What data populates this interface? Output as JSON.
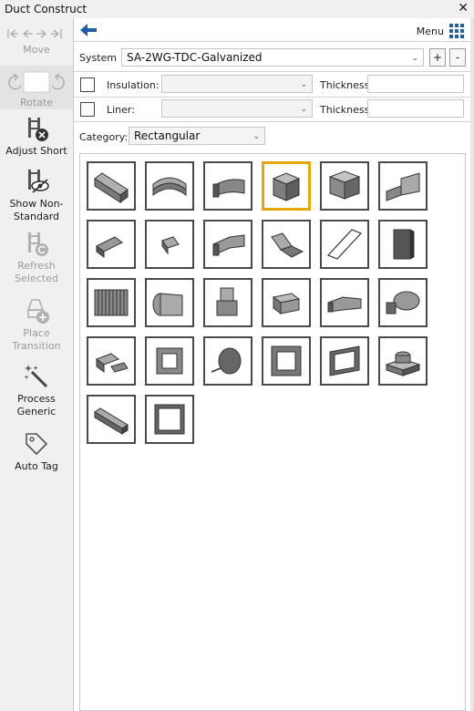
{
  "window": {
    "title": "Duct Construct",
    "close_glyph": "✕"
  },
  "left_panel": {
    "move_label": "Move",
    "rotate_label": "Rotate",
    "tools": [
      {
        "label": "Adjust Short",
        "icon": "adjust-short-icon",
        "enabled": true
      },
      {
        "label": "Show Non-Standard",
        "icon": "show-non-standard-icon",
        "enabled": true
      },
      {
        "label": "Refresh Selected",
        "icon": "refresh-selected-icon",
        "enabled": false
      },
      {
        "label": "Place Transition",
        "icon": "place-transition-icon",
        "enabled": false
      },
      {
        "label": "Process Generic",
        "icon": "magic-wand-icon",
        "enabled": true
      },
      {
        "label": "Auto Tag",
        "icon": "tag-icon",
        "enabled": true
      }
    ]
  },
  "header": {
    "menu_label": "Menu"
  },
  "system": {
    "label": "System",
    "value": "SA-2WG-TDC-Galvanized",
    "add_label": "+",
    "remove_label": "-"
  },
  "insulation": {
    "label": "Insulation:",
    "thickness_label": "Thickness:",
    "value": "",
    "thickness_value": ""
  },
  "liner": {
    "label": "Liner:",
    "thickness_label": "Thickness:",
    "value": "",
    "thickness_value": ""
  },
  "category": {
    "label": "Category:",
    "value": "Rectangular"
  },
  "colors": {
    "accent_blue": "#1f5fa8",
    "selection": "#e8a50a",
    "fitting_gray": "#8c8c8c"
  },
  "fittings": [
    {
      "icon": "straight-duct-icon",
      "selected": false
    },
    {
      "icon": "radius-elbow-icon",
      "selected": false
    },
    {
      "icon": "curved-elbow-icon",
      "selected": false
    },
    {
      "icon": "square-box-icon",
      "selected": true
    },
    {
      "icon": "plenum-box-icon",
      "selected": false
    },
    {
      "icon": "offset-transition-icon",
      "selected": false
    },
    {
      "icon": "angled-takeoff-icon",
      "selected": false
    },
    {
      "icon": "small-connector-icon",
      "selected": false
    },
    {
      "icon": "wye-branch-icon",
      "selected": false
    },
    {
      "icon": "offset-elbow-icon",
      "selected": false
    },
    {
      "icon": "flat-panel-icon",
      "selected": false
    },
    {
      "icon": "end-cap-icon",
      "selected": false
    },
    {
      "icon": "flex-duct-icon",
      "selected": false
    },
    {
      "icon": "round-to-rect-icon",
      "selected": false
    },
    {
      "icon": "boot-fitting-icon",
      "selected": false
    },
    {
      "icon": "transition-box-icon",
      "selected": false
    },
    {
      "icon": "reducer-icon",
      "selected": false
    },
    {
      "icon": "tee-branch-icon",
      "selected": false
    },
    {
      "icon": "damper-tee-icon",
      "selected": false
    },
    {
      "icon": "square-frame-icon",
      "selected": false
    },
    {
      "icon": "round-damper-icon",
      "selected": false
    },
    {
      "icon": "square-collar-icon",
      "selected": false
    },
    {
      "icon": "access-door-icon",
      "selected": false
    },
    {
      "icon": "round-takeoff-box-icon",
      "selected": false
    },
    {
      "icon": "long-straight-duct-icon",
      "selected": false
    },
    {
      "icon": "flange-frame-icon",
      "selected": false
    }
  ]
}
